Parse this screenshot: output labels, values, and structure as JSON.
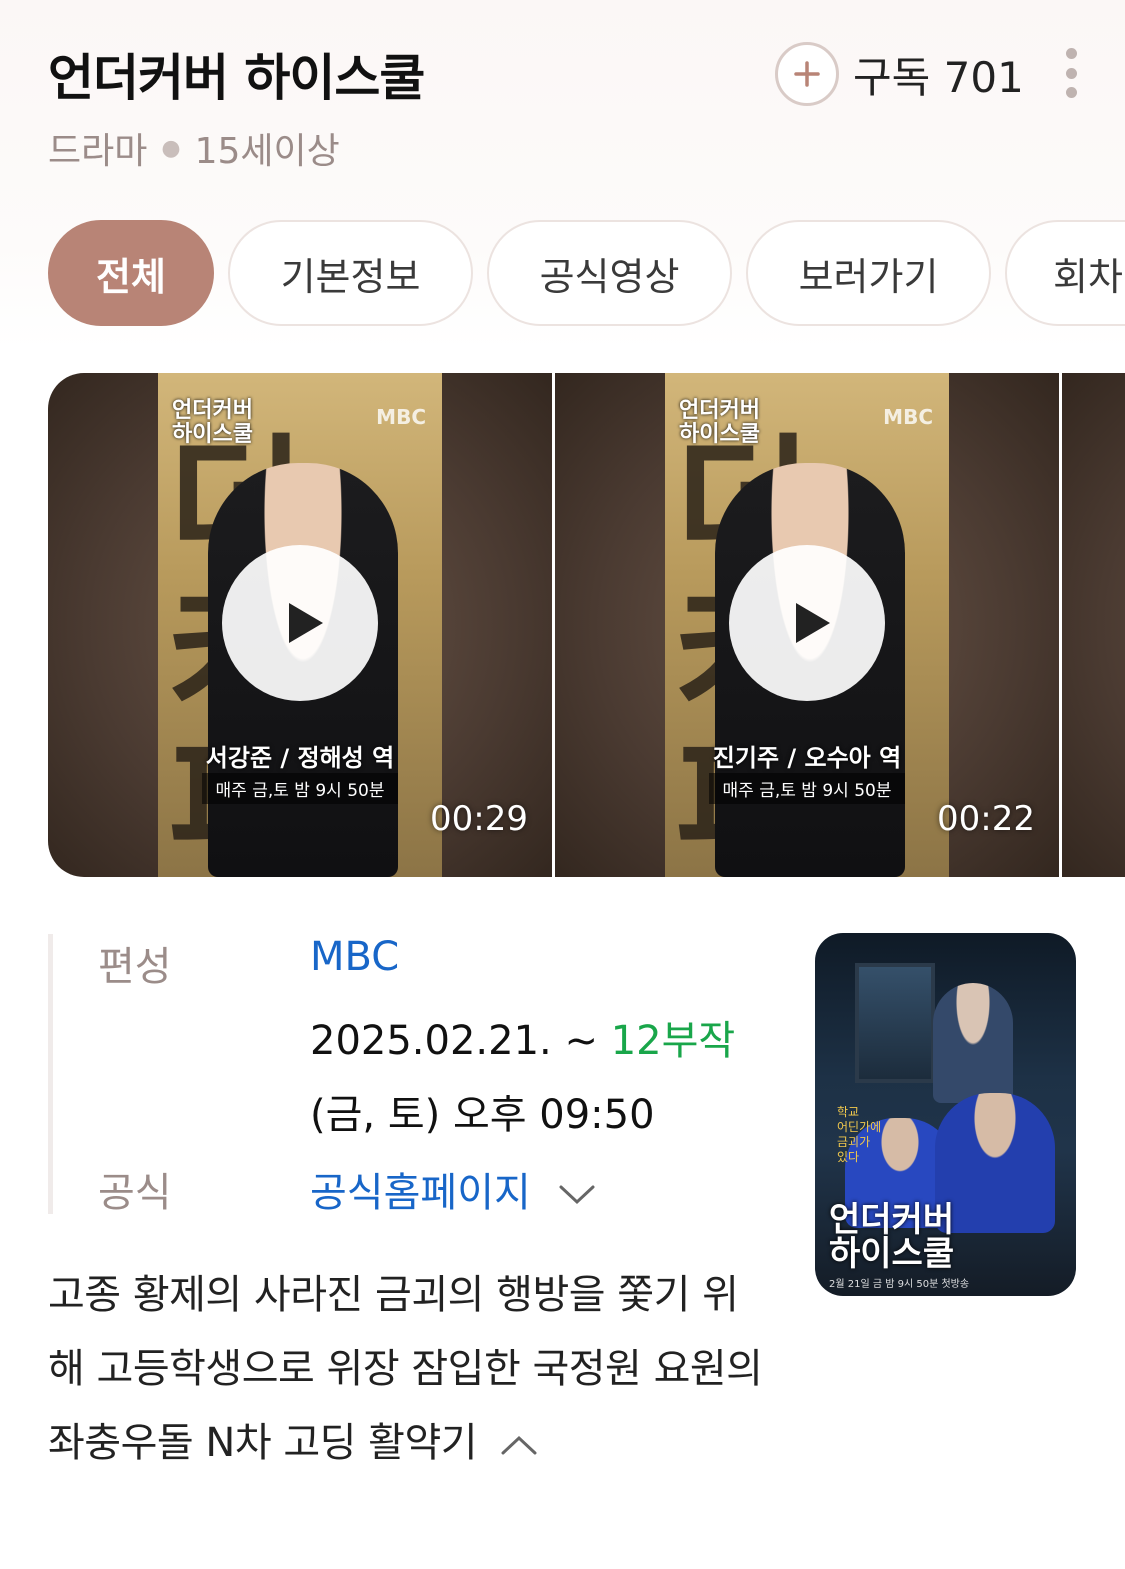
{
  "header": {
    "title": "언더커버 하이스쿨",
    "genre": "드라마",
    "rating": "15세이상",
    "subscribe_label": "구독 701"
  },
  "tabs": [
    {
      "label": "전체",
      "active": true
    },
    {
      "label": "기본정보",
      "active": false
    },
    {
      "label": "공식영상",
      "active": false
    },
    {
      "label": "보러가기",
      "active": false
    },
    {
      "label": "회차",
      "active": false
    }
  ],
  "videos": [
    {
      "duration": "00:29",
      "poster_logo": "언더커버\n하이스쿨",
      "poster_channel": "MBC",
      "actor_caption": "서강준 / 정해성 역",
      "schedule_caption": "매주 금,토 밤 9시 50분"
    },
    {
      "duration": "00:22",
      "poster_logo": "언더커버\n하이스쿨",
      "poster_channel": "MBC",
      "actor_caption": "진기주 / 오수아 역",
      "schedule_caption": "매주 금,토 밤 9시 50분"
    }
  ],
  "info": {
    "broadcast_label": "편성",
    "broadcaster": "MBC",
    "date_range": "2025.02.21. ~",
    "episodes": "12부작",
    "airtime": "(금, 토) 오후 09:50",
    "official_label": "공식",
    "homepage_link": "공식홈페이지"
  },
  "poster": {
    "logo": "언더커버\n하이스쿨",
    "quote": "학교\n어딘가에\n금괴가\n있다",
    "airinfo": "2월 21일 금 밤 9시 50분 첫방송"
  },
  "description": "고종 황제의 사라진 금괴의 행방을 쫓기 위해 고등학생으로 위장 잠입한 국정원 요원의 좌충우돌 N차 고딩 활약기",
  "colors": {
    "accent": "#b88476",
    "link": "#1866c8",
    "episodes": "#19a64a",
    "muted": "#9b8c89"
  }
}
